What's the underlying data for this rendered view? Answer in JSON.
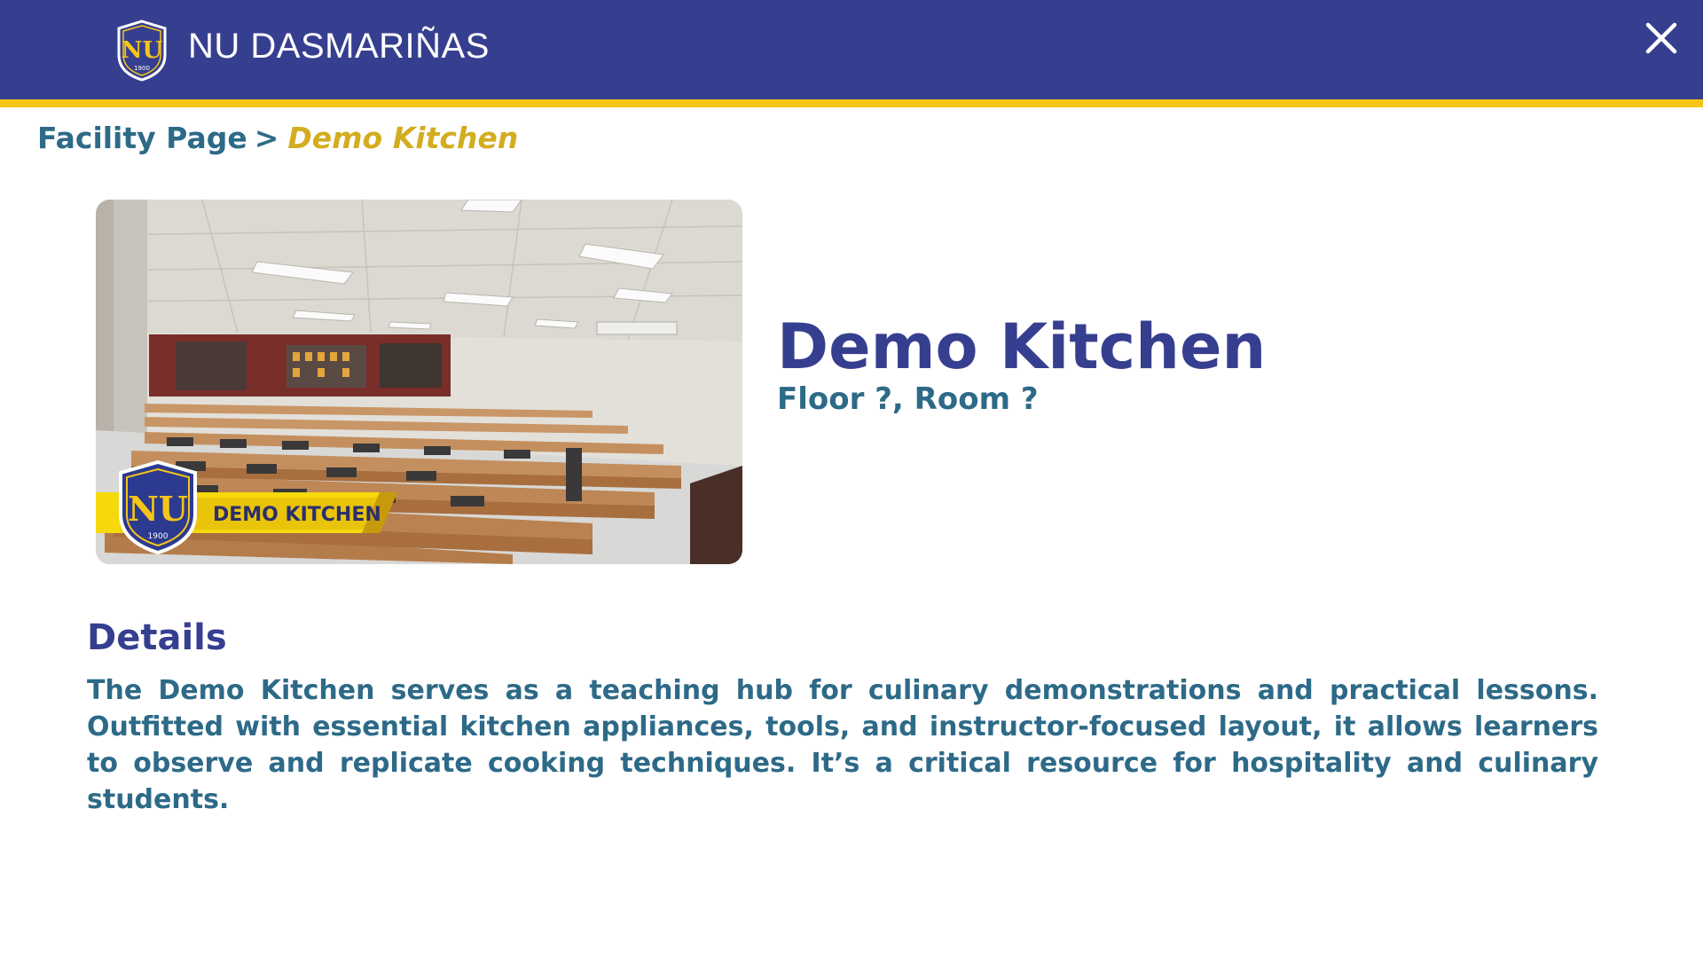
{
  "header": {
    "brand": "NU DASMARIÑAS",
    "logo_icon": "nu-shield-logo",
    "logo_year": "1900",
    "close_icon": "close-icon",
    "background_color": "#363f8f",
    "accent_color": "#f5c518"
  },
  "breadcrumb": {
    "root": "Facility Page",
    "separator": ">",
    "current": "Demo Kitchen"
  },
  "facility": {
    "photo_banner_label": "DEMO KITCHEN",
    "photo_logo_year": "1900",
    "name": "Demo Kitchen",
    "location": "Floor ?, Room ?"
  },
  "details": {
    "heading": "Details",
    "text": "The Demo Kitchen serves as a teaching hub for culinary demonstrations and practical lessons. Outfitted with essential kitchen appliances, tools, and instructor-focused layout, it allows learners to observe and replicate cooking techniques. It’s a critical resource for hospitality and culinary students."
  }
}
